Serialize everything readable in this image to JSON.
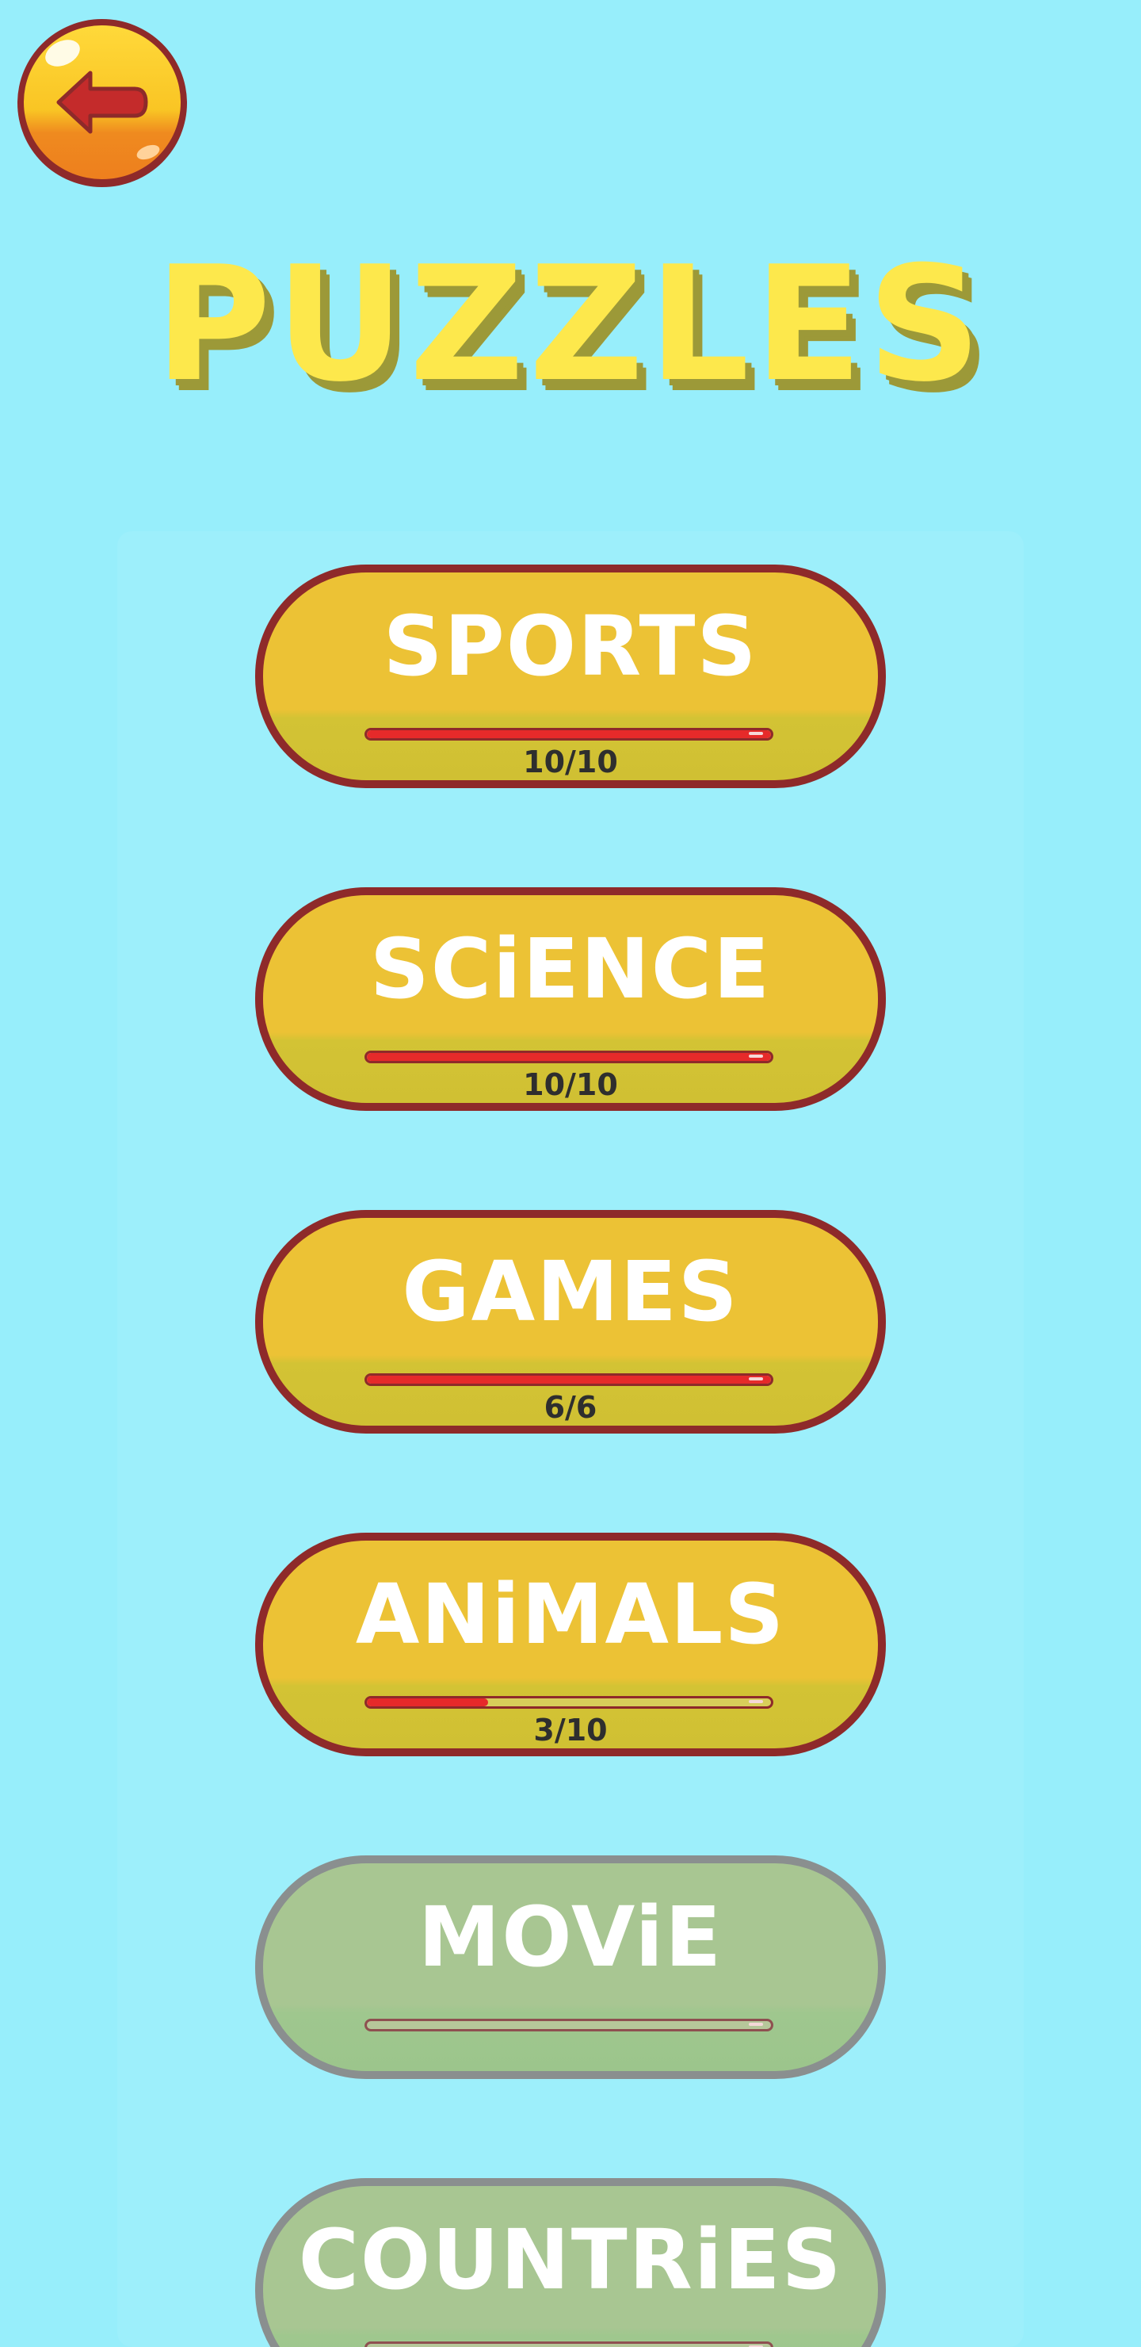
{
  "header": {
    "title": "PUZZLES",
    "back_icon": "back-arrow-icon"
  },
  "colors": {
    "background": "#97eefb",
    "card_unlocked": "#ecc235",
    "card_locked": "#a8c692",
    "border_unlocked": "#8e2a2a",
    "border_locked": "#8a8f8f",
    "progress_fill": "#e62a2a",
    "title": "#fde84c"
  },
  "categories": [
    {
      "name": "SPORTS",
      "progress_text": "10/10",
      "progress": 1.0,
      "locked": false
    },
    {
      "name": "SCiENCE",
      "progress_text": "10/10",
      "progress": 1.0,
      "locked": false
    },
    {
      "name": "GAMES",
      "progress_text": "6/6",
      "progress": 1.0,
      "locked": false
    },
    {
      "name": "ANiMALS",
      "progress_text": "3/10",
      "progress": 0.3,
      "locked": false
    },
    {
      "name": "MOViE",
      "progress_text": "",
      "progress": 0.0,
      "locked": true
    },
    {
      "name": "COUNTRiES",
      "progress_text": "",
      "progress": 0.0,
      "locked": true
    }
  ]
}
